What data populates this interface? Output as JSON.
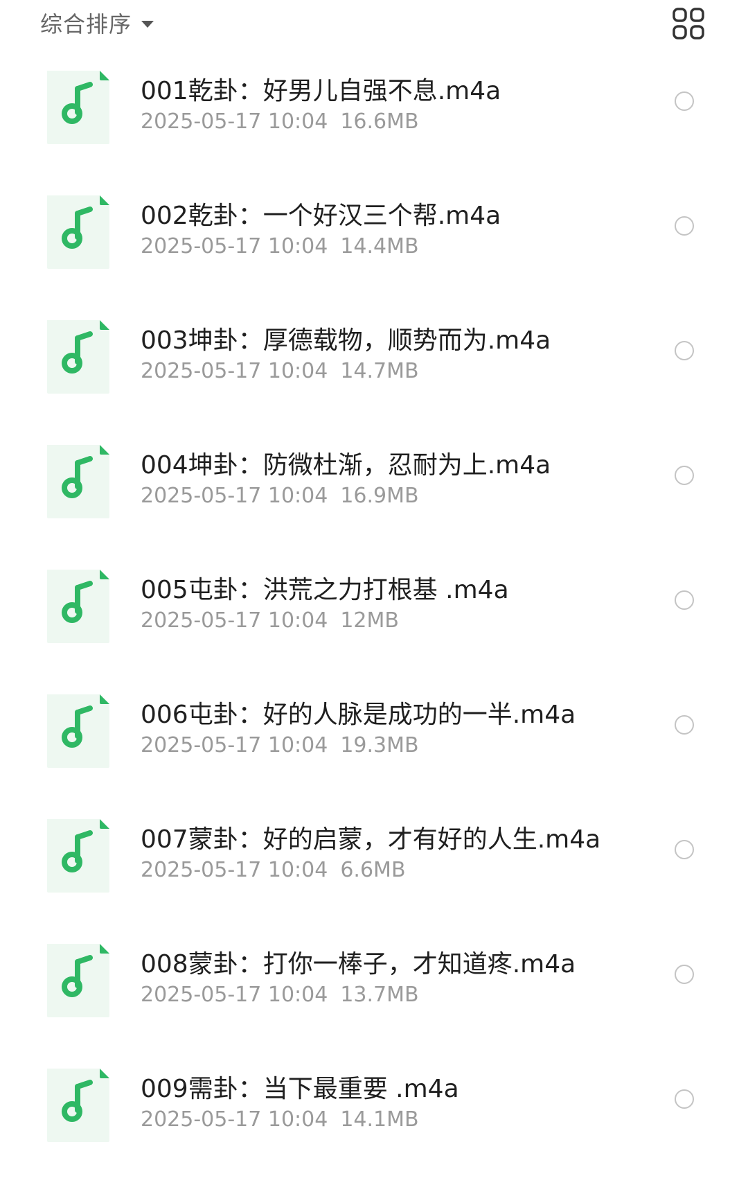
{
  "toolbar": {
    "sort_label": "综合排序",
    "sort_caret_icon": "caret-down-icon",
    "view_toggle_icon": "grid-view-icon"
  },
  "colors": {
    "accent_green": "#2fb864",
    "icon_bg": "#eef8f1",
    "meta_text": "#9a9a9a",
    "radio_border": "#c4c4c4"
  },
  "files": [
    {
      "name": "001乾卦：好男儿自强不息.m4a",
      "date": "2025-05-17 10:04",
      "size": "16.6MB"
    },
    {
      "name": "002乾卦：一个好汉三个帮.m4a",
      "date": "2025-05-17 10:04",
      "size": "14.4MB"
    },
    {
      "name": "003坤卦：厚德载物，顺势而为.m4a",
      "date": "2025-05-17 10:04",
      "size": "14.7MB"
    },
    {
      "name": "004坤卦：防微杜渐，忍耐为上.m4a",
      "date": "2025-05-17 10:04",
      "size": "16.9MB"
    },
    {
      "name": "005屯卦：洪荒之力打根基  .m4a",
      "date": "2025-05-17 10:04",
      "size": "12MB"
    },
    {
      "name": "006屯卦：好的人脉是成功的一半.m4a",
      "date": "2025-05-17 10:04",
      "size": "19.3MB"
    },
    {
      "name": "007蒙卦：好的启蒙，才有好的人生.m4a",
      "date": "2025-05-17 10:04",
      "size": "6.6MB"
    },
    {
      "name": "008蒙卦：打你一棒子，才知道疼.m4a",
      "date": "2025-05-17 10:04",
      "size": "13.7MB"
    },
    {
      "name": "009需卦：当下最重要  .m4a",
      "date": "2025-05-17 10:04",
      "size": "14.1MB"
    }
  ]
}
